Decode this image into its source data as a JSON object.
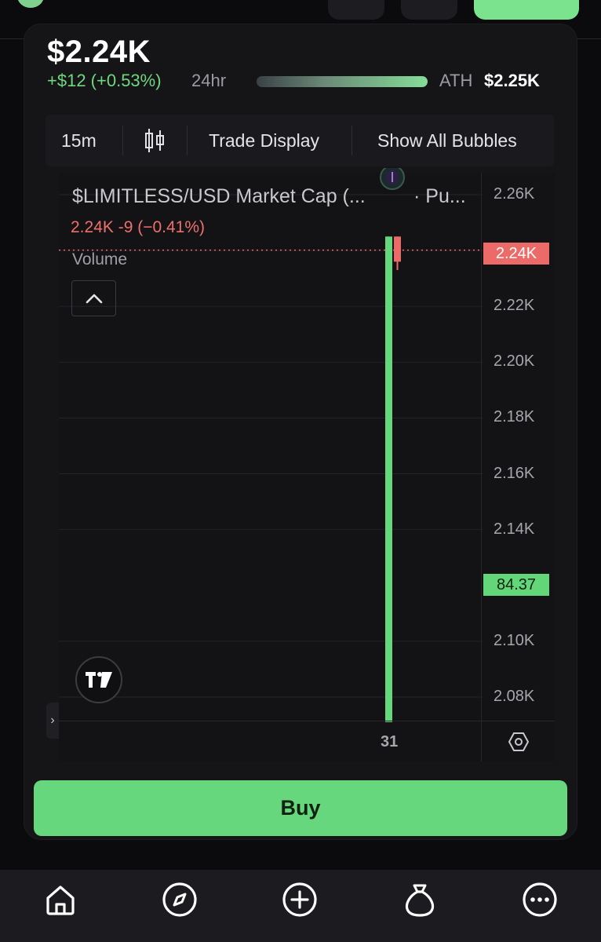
{
  "header": {
    "price": "$2.24K",
    "change": "+$12 (+0.53%)",
    "window": "24hr",
    "ath_label": "ATH",
    "ath_value": "$2.25K",
    "ath_progress": 0.995
  },
  "toolbar": {
    "interval": "15m",
    "candle_icon": "candlestick-icon",
    "trade_display": "Trade Display",
    "show_bubbles": "Show All Bubbles"
  },
  "chart": {
    "title": "$LIMITLESS/USD Market Cap (...",
    "title_suffix": "· Pu...",
    "ohlc": "2.24K  -9 (−0.41%)",
    "volume_label": "Volume",
    "x_label": "31",
    "current_price_tag": "2.24K",
    "volume_tag": "84.37",
    "colors": {
      "up": "#66d77d",
      "down": "#ec6b68",
      "background": "#131316"
    }
  },
  "chart_data": {
    "type": "bar",
    "title": "$LIMITLESS/USD Market Cap (...",
    "y_ticks": [
      "2.26K",
      "2.24K",
      "2.22K",
      "2.20K",
      "2.18K",
      "2.16K",
      "2.14K",
      "2.10K",
      "2.08K"
    ],
    "x_ticks": [
      "31"
    ],
    "ylim": [
      2.07,
      2.27
    ],
    "candles": [
      {
        "open": 2.245,
        "high": 2.245,
        "low": 2.06,
        "close": 2.245,
        "color": "up"
      },
      {
        "open": 2.245,
        "high": 2.245,
        "low": 2.233,
        "close": 2.236,
        "color": "down"
      }
    ],
    "current_price": 2.24,
    "volume": 84.37,
    "grid": true
  },
  "actions": {
    "buy_label": "Buy"
  },
  "nav": {
    "home_icon": "home-icon",
    "explore_icon": "compass-icon",
    "create_icon": "plus-circle-icon",
    "wallet_icon": "money-bag-icon",
    "more_icon": "more-icon"
  }
}
